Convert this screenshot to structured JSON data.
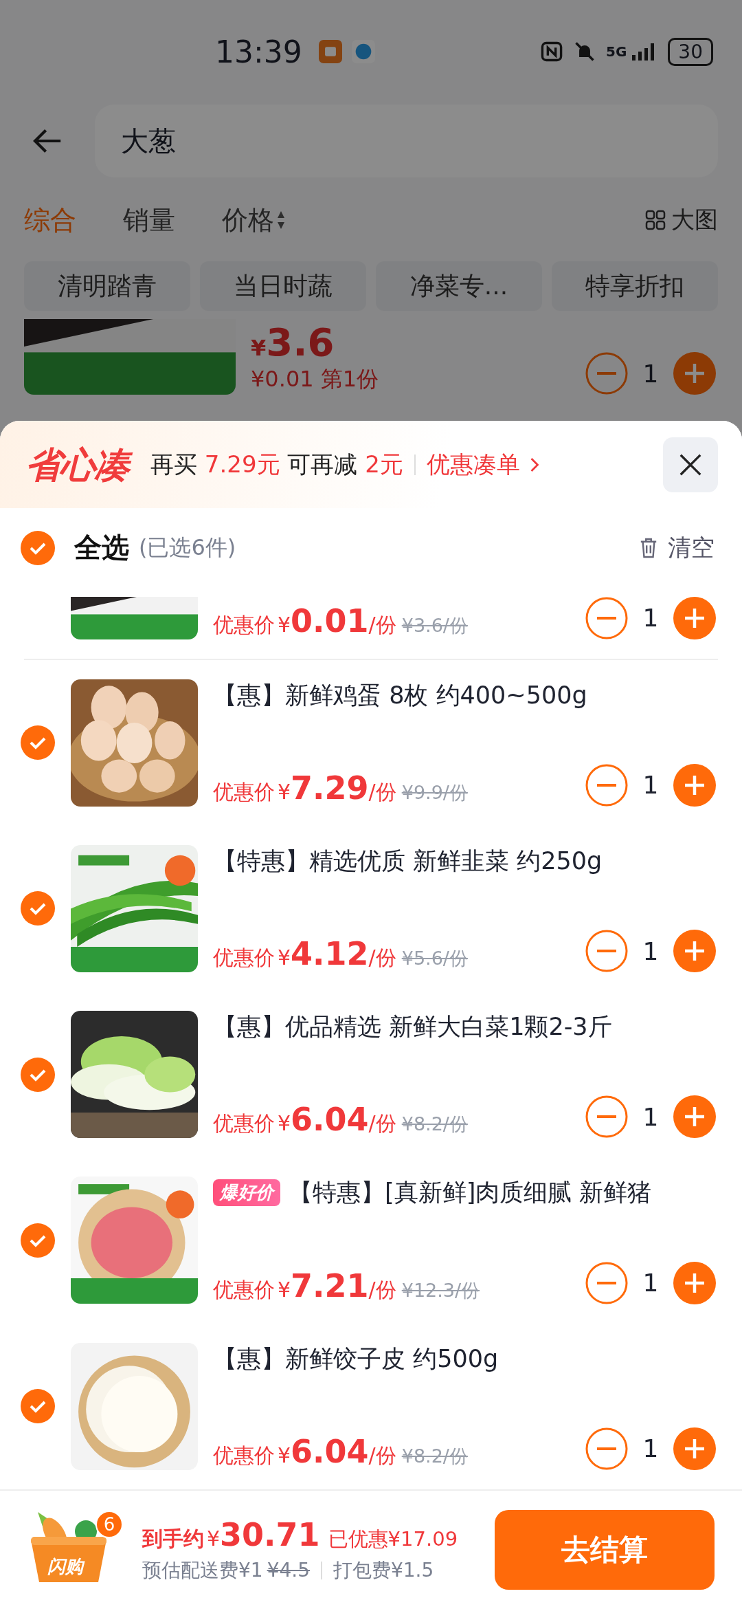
{
  "status_bar": {
    "time": "13:39",
    "network": "5G",
    "battery": "30"
  },
  "search": {
    "value": "大葱"
  },
  "sort_tabs": [
    {
      "label": "综合",
      "selected": true,
      "sortable": false
    },
    {
      "label": "销量",
      "selected": false,
      "sortable": false
    },
    {
      "label": "价格",
      "selected": false,
      "sortable": true
    }
  ],
  "view_toggle": "大图",
  "chips": [
    "清明踏青",
    "当日时蔬",
    "净菜专...",
    "特享折扣"
  ],
  "background_product": {
    "currency": "¥",
    "price": "3.6",
    "first_price": "¥0.01 第1份",
    "quantity": "1"
  },
  "sheet": {
    "logo": "省心凑",
    "promo": [
      {
        "text": "再买 ",
        "highlight": false
      },
      {
        "text": "7.29元",
        "highlight": true
      },
      {
        "text": " 可再减 ",
        "highlight": false
      },
      {
        "text": "2元",
        "highlight": true
      }
    ],
    "link": "优惠凑单",
    "select_all": {
      "label": "全选",
      "count": "(已选6件)",
      "checked": true
    },
    "clear": "清空",
    "items": [
      {
        "kind": "partial",
        "price_label": "优惠价",
        "currency": "¥",
        "price": "0.01",
        "unit": "/份",
        "original_price": "¥3.6/份",
        "quantity": "1"
      },
      {
        "kind": "full",
        "title": "【惠】新鲜鸡蛋 8枚 约400~500g",
        "price_label": "优惠价",
        "currency": "¥",
        "price": "7.29",
        "unit": "/份",
        "original_price": "¥9.9/份",
        "quantity": "1",
        "selected": true
      },
      {
        "kind": "full",
        "title": "【特惠】精选优质 新鲜韭菜 约250g",
        "price_label": "优惠价",
        "currency": "¥",
        "price": "4.12",
        "unit": "/份",
        "original_price": "¥5.6/份",
        "quantity": "1",
        "selected": true
      },
      {
        "kind": "full",
        "title": "【惠】优品精选 新鲜大白菜1颗2-3斤",
        "price_label": "优惠价",
        "currency": "¥",
        "price": "6.04",
        "unit": "/份",
        "original_price": "¥8.2/份",
        "quantity": "1",
        "selected": true
      },
      {
        "kind": "full",
        "badge": "爆好价",
        "title": "【特惠】[真新鲜]肉质细腻 新鲜猪",
        "price_label": "优惠价",
        "currency": "¥",
        "price": "7.21",
        "unit": "/份",
        "original_price": "¥12.3/份",
        "quantity": "1",
        "selected": true
      },
      {
        "kind": "full",
        "title": "【惠】新鲜饺子皮 约500g",
        "price_label": "优惠价",
        "currency": "¥",
        "price": "6.04",
        "unit": "/份",
        "original_price": "¥8.2/份",
        "quantity": "1",
        "selected": true
      }
    ]
  },
  "footer": {
    "cart_label": "闪购",
    "cart_count": "6",
    "total_label": "到手约",
    "currency": "¥",
    "total": "30.71",
    "saved": "已优惠¥17.09",
    "delivery": "预估配送费¥1",
    "delivery_original": "¥4.5",
    "packing": "打包费¥1.5",
    "checkout": "去结算"
  }
}
